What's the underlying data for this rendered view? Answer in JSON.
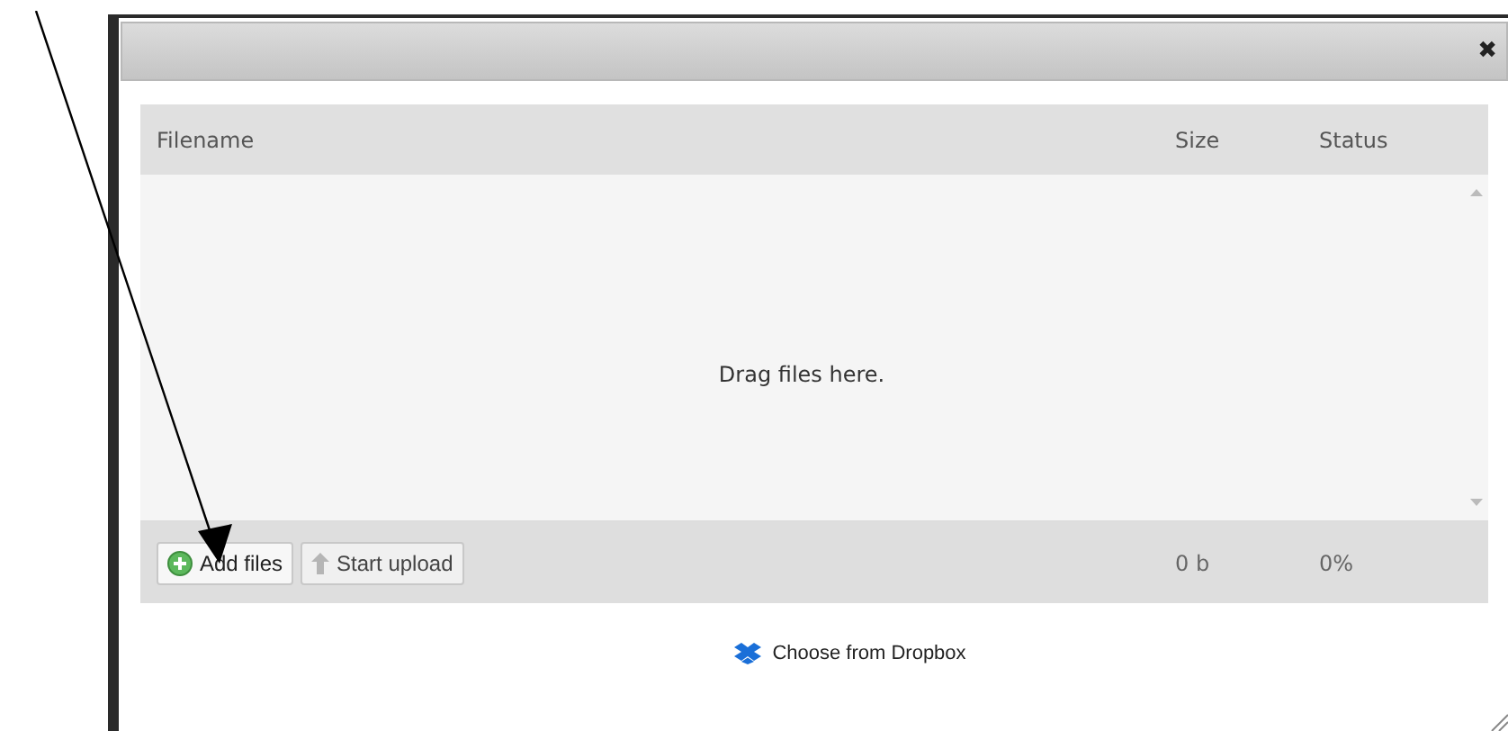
{
  "dialog": {
    "close": "✖"
  },
  "table": {
    "columns": [
      "Filename",
      "Size",
      "Status"
    ],
    "empty_message": "Drag files here.",
    "footer": {
      "buttons": [
        {
          "label": "Add files",
          "kind": "add",
          "disabled": false
        },
        {
          "label": "Start upload",
          "kind": "upload",
          "disabled": true
        }
      ],
      "size": "0 b",
      "status": "0%"
    }
  },
  "dropbox": {
    "label": "Choose from Dropbox"
  }
}
